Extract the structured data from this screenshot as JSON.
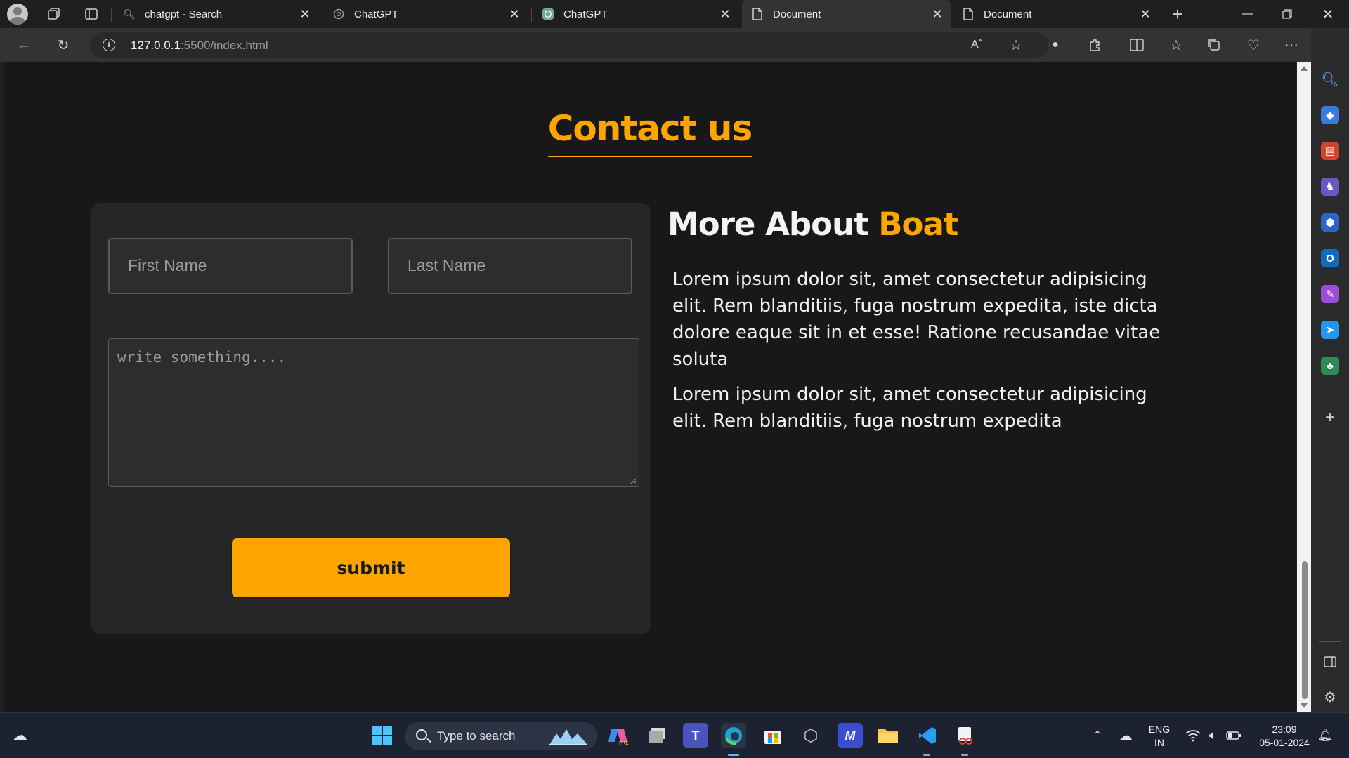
{
  "browser": {
    "tabs": [
      {
        "title": "chatgpt - Search",
        "icon": "search-icon",
        "active": false
      },
      {
        "title": "ChatGPT",
        "icon": "chatgpt-icon",
        "active": false
      },
      {
        "title": "ChatGPT",
        "icon": "chatgpt-icon",
        "active": false
      },
      {
        "title": "Document",
        "icon": "document-icon",
        "active": true
      },
      {
        "title": "Document",
        "icon": "document-icon",
        "active": false
      }
    ],
    "url_host": "127.0.0.1",
    "url_path": ":5500/index.html"
  },
  "page": {
    "title": "Contact us",
    "form": {
      "first_name_placeholder": "First Name",
      "last_name_placeholder": "Last Name",
      "message_placeholder": "write something....",
      "submit_label": "submit"
    },
    "about": {
      "title_main": "More About",
      "title_accent": "Boat",
      "para1": "Lorem ipsum dolor sit, amet consectetur adipisicing elit. Rem blanditiis, fuga nostrum expedita, iste dicta dolore eaque sit in et esse! Ratione recusandae vitae soluta",
      "para2": "Lorem ipsum dolor sit, amet consectetur adipisicing elit. Rem blanditiis, fuga nostrum expedita"
    }
  },
  "taskbar": {
    "search_placeholder": "Type to search",
    "lang_line1": "ENG",
    "lang_line2": "IN",
    "time": "23:09",
    "date": "05-01-2024"
  },
  "colors": {
    "accent": "#ffa500",
    "page_bg": "#181818",
    "card_bg": "#262626"
  }
}
